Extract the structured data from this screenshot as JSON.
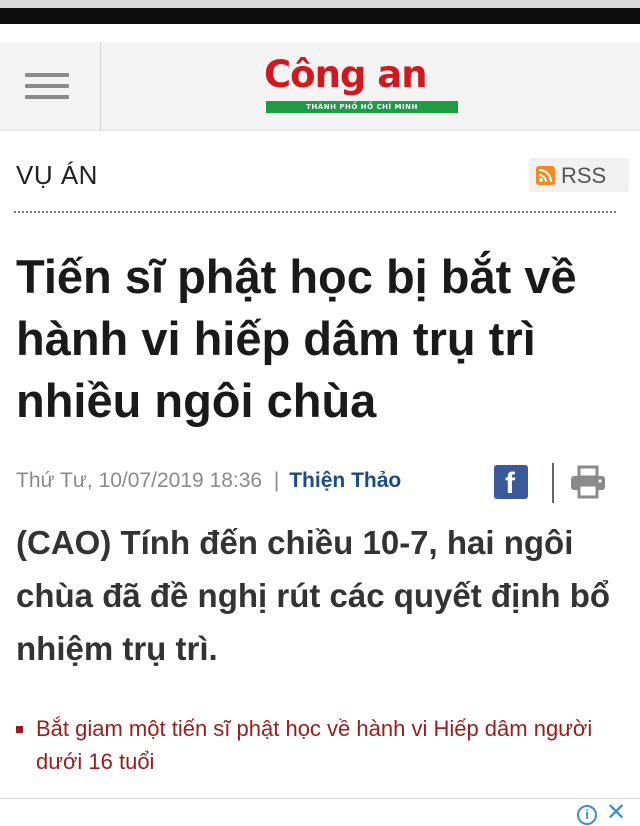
{
  "header": {
    "logo_main": "Công an",
    "logo_sub": "THÀNH PHỐ HỒ CHÍ MINH"
  },
  "section": {
    "title": "VỤ ÁN",
    "rss_label": "RSS"
  },
  "article": {
    "headline": "Tiến sĩ phật học bị bắt về hành vi hiếp dâm trụ trì nhiều ngôi chùa",
    "date": "Thứ Tư, 10/07/2019 18:36",
    "separator": "|",
    "author": "Thiện Thảo",
    "lead": "(CAO) Tính đến chiều 10-7, hai ngôi chùa đã đề nghị rút các quyết định bổ nhiệm trụ trì.",
    "related_link": "Bắt giam một tiến sĩ phật học về hành vi Hiếp dâm người dưới 16 tuổi"
  },
  "icons": {
    "menu": "hamburger-menu-icon",
    "rss": "rss-icon",
    "facebook": "facebook-icon",
    "print": "printer-icon",
    "ad_info": "info-icon",
    "ad_close": "close-icon"
  },
  "colors": {
    "brand_red": "#d0191f",
    "brand_green": "#1f9a45",
    "author_blue": "#1c4c86",
    "link_red": "#9b1c1c",
    "facebook_blue": "#3b5998",
    "rss_orange": "#f08a24"
  }
}
